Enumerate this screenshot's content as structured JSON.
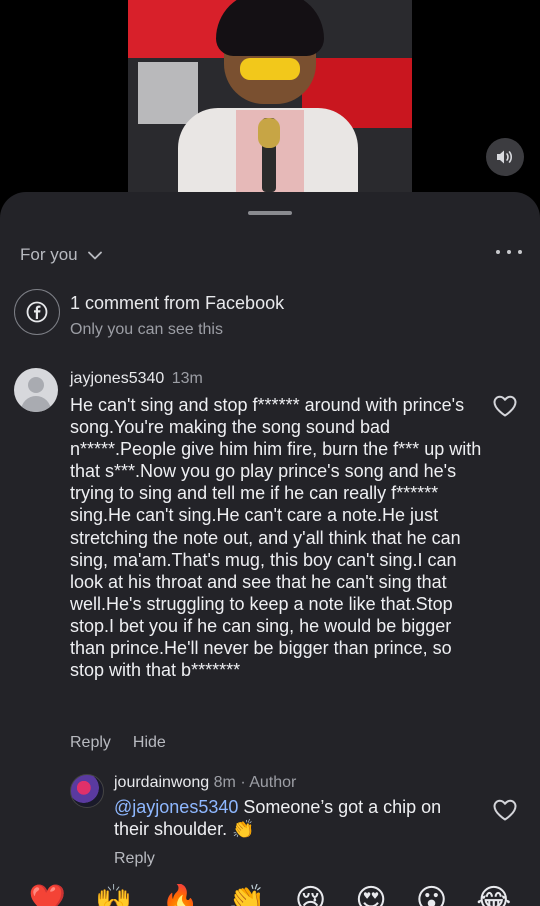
{
  "video": {
    "volume_icon": "speaker-volume-icon"
  },
  "sheet": {
    "feed_filter": "For you",
    "more_icon": "more-dots-icon",
    "notice": {
      "icon": "facebook-icon",
      "title": "1 comment from Facebook",
      "subtitle": "Only you can see this"
    },
    "comment": {
      "username": "jayjones5340",
      "time": "13m",
      "text": "He can't sing and stop f****** around with prince's song.You're making the song sound bad n*****.People give him him fire, burn the f*** up with that s***.Now you go play prince's song and he's trying to sing and tell me if he can really f****** sing.He can't sing.He can't care a note.He just stretching the note out, and y'all think that he can sing, ma'am.That's mug, this boy can't sing.I can look at his throat and see that he can't sing that well.He's struggling to keep a note like that.Stop stop.I bet you if he can sing, he would be bigger than prince.He'll never be bigger than prince, so stop with that b*******",
      "reply_label": "Reply",
      "hide_label": "Hide"
    },
    "author_reply": {
      "username": "jourdainwong",
      "meta": "8m · Author",
      "mention": "@jayjones5340",
      "text": " Someone’s got a chip on their shoulder. 👏",
      "reply_label": "Reply"
    },
    "reactions": [
      "❤️",
      "🙌",
      "🔥",
      "👏",
      "😢",
      "😍",
      "😮",
      "😂"
    ]
  }
}
